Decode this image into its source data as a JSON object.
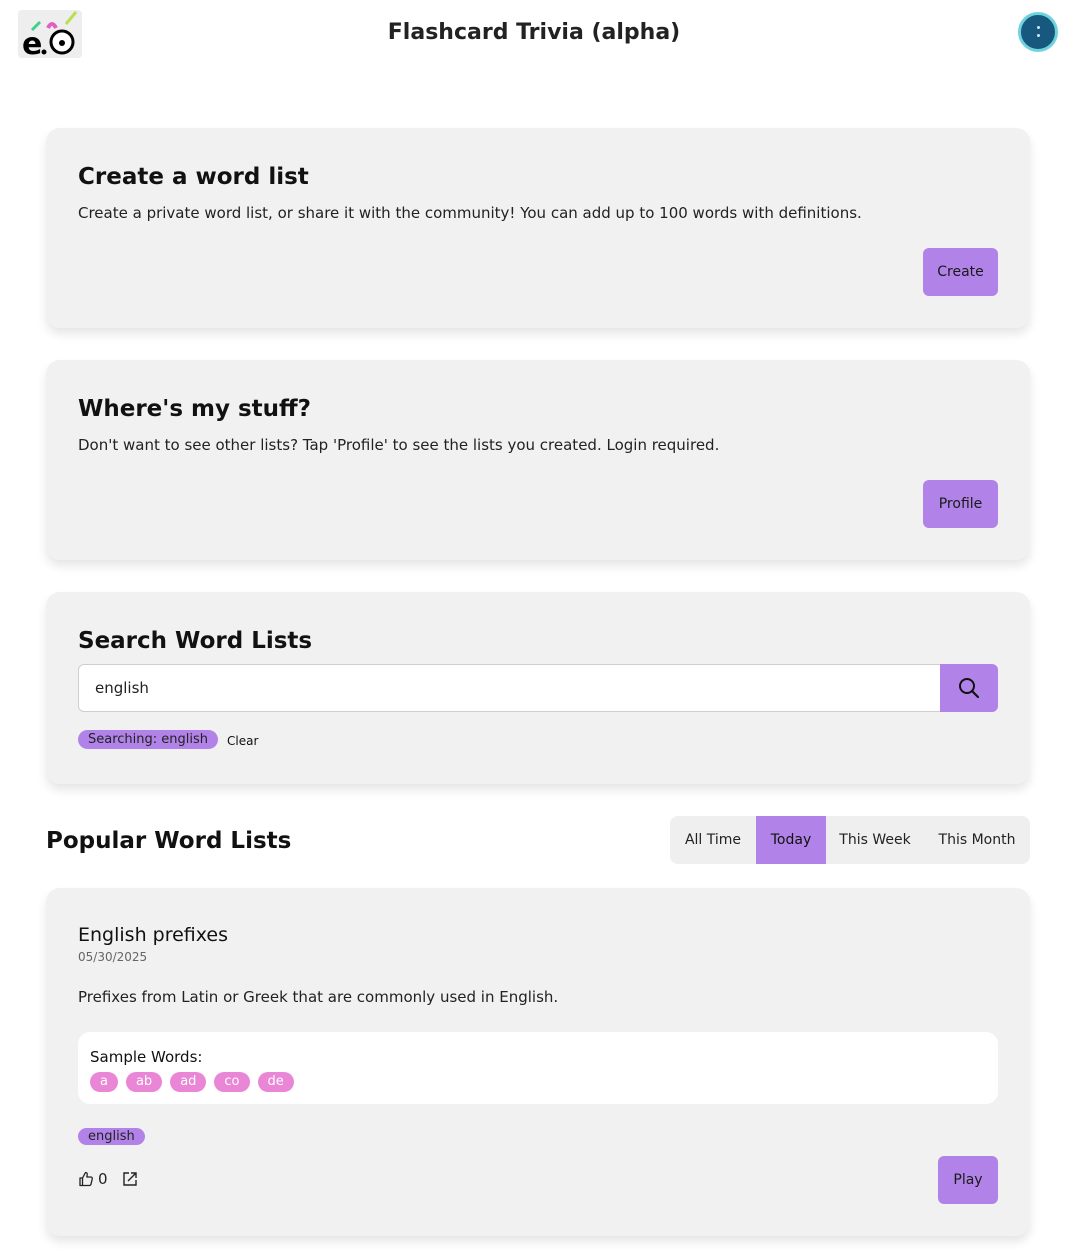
{
  "header": {
    "title": "Flashcard Trivia (alpha)",
    "logo_icon": "logo-icon",
    "avatar_icon": "avatar-icon"
  },
  "create_card": {
    "title": "Create a word list",
    "text": "Create a private word list, or share it with the community! You can add up to 100 words with definitions.",
    "button_label": "Create"
  },
  "stuff_card": {
    "title": "Where's my stuff?",
    "text": "Don't want to see other lists? Tap 'Profile' to see the lists you created. Login required.",
    "button_label": "Profile"
  },
  "search_card": {
    "title": "Search Word Lists",
    "input_value": "english",
    "search_icon": "search-icon",
    "chip_label": "Searching: english",
    "clear_label": "Clear"
  },
  "popular": {
    "title": "Popular Word Lists",
    "tabs": [
      {
        "label": "All Time",
        "active": false
      },
      {
        "label": "Today",
        "active": true
      },
      {
        "label": "This Week",
        "active": false
      },
      {
        "label": "This Month",
        "active": false
      }
    ]
  },
  "list_item": {
    "title": "English prefixes",
    "date": "05/30/2025",
    "description": "Prefixes from Latin or Greek that are commonly used in English.",
    "sample_label": "Sample Words:",
    "sample_words": [
      "a",
      "ab",
      "ad",
      "co",
      "de"
    ],
    "tag": "english",
    "likes": "0",
    "play_label": "Play"
  },
  "colors": {
    "accent": "#b183e8",
    "word_chip": "#e986d6",
    "card_bg": "#f1f1f1",
    "avatar": "#17587f"
  }
}
